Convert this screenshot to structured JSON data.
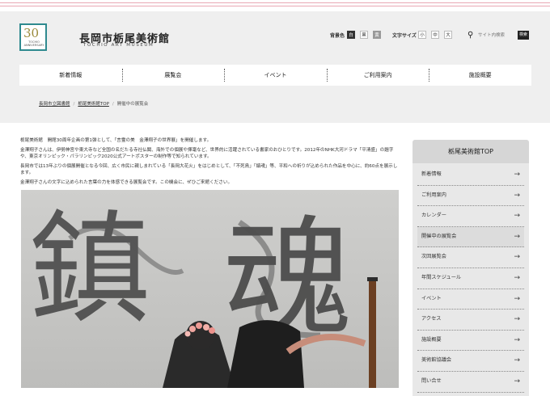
{
  "header": {
    "site_title": "長岡市栃尾美術館",
    "site_subtitle": "TOCHIO ART MUSEUM",
    "logo_number": "30",
    "logo_sub": "TOCHIO ANNIVERSARY"
  },
  "controls": {
    "bg_label": "背景色",
    "bg_options": [
      "白",
      "黒",
      "黄"
    ],
    "size_label": "文字サイズ",
    "size_options": [
      "小",
      "中",
      "大"
    ],
    "search_placeholder": "サイト内検索",
    "search_button": "検索"
  },
  "nav": [
    "新着情報",
    "展覧会",
    "イベント",
    "ご利用案内",
    "施設概要"
  ],
  "breadcrumb": [
    "長岡市立図書館",
    "栃尾美術館TOP",
    "開催中の展覧会"
  ],
  "content": {
    "paragraphs": [
      "栃尾美術館　開館30周年企画の第1弾として、「言霊の美　金澤翔子の世界展」を開催します。",
      "金澤翔子さんは、伊勢神宮や東大寺など全国の名だたる寺社仏閣、海外での個展や揮毫など、世界的に活躍されている書家のおひとりです。2012年のNHK大河ドラマ「平清盛」の題字や、東京オリンピック・パラリンピック2020公式アートポスターの制作等で知られています。",
      "長岡市では13年ぶりの個展開催となる今回、広く市民に親しまれている「長岡大花火」をはじめとして、「不死鳥」「鎮魂」等、平和への祈りが込められた作品を中心に、約60点を展示します。",
      "金澤翔子さんの文字に込められた言葉の力を体感できる展覧会です。この機会に、ぜひご来館ください。"
    ],
    "poster_calligraphy": [
      "鎮",
      "魂"
    ]
  },
  "sidebar": {
    "title": "栃尾美術館TOP",
    "items": [
      "新着情報",
      "ご利用案内",
      "カレンダー",
      "開催中の展覧会",
      "次回展覧会",
      "年間スケジュール",
      "イベント",
      "アクセス",
      "施設概要",
      "美術館協議会",
      "問い合せ"
    ],
    "active_index": 3
  },
  "colors": {
    "teal": "#2f8a8f",
    "pink_rule": "#e9a7b4",
    "hero_bg": "#efefef"
  }
}
